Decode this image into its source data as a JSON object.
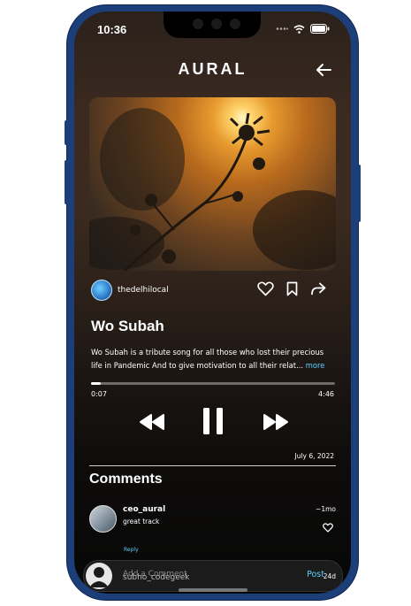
{
  "status_bar": {
    "time": "10:36"
  },
  "header": {
    "app_title": "AURAL"
  },
  "post": {
    "username": "thedelhilocal",
    "song_title": "Wo Subah",
    "description": "Wo Subah is a tribute song for all those who lost their precious life in Pandemic  And to give motivation to all their relat...",
    "more_label": "more",
    "current_time": "0:07",
    "total_time": "4:46",
    "progress": 0.04,
    "date": "July 6, 2022"
  },
  "comments": {
    "title": "Comments",
    "items": [
      {
        "username": "ceo_aural",
        "text": "great track",
        "time": "~1mo",
        "reply_label": "Reply"
      }
    ]
  },
  "comment_bar": {
    "placeholder": "Add a Comment",
    "username": "subho_codegeek",
    "post_label": "Post",
    "time": "24d"
  },
  "icons": {
    "back": "arrow-left-icon",
    "like": "heart-icon",
    "bookmark": "bookmark-icon",
    "share": "share-icon",
    "rewind": "rewind-icon",
    "pause": "pause-icon",
    "forward": "fast-forward-icon"
  },
  "colors": {
    "accent": "#5bd0ff",
    "frame": "#1c3f7a"
  }
}
